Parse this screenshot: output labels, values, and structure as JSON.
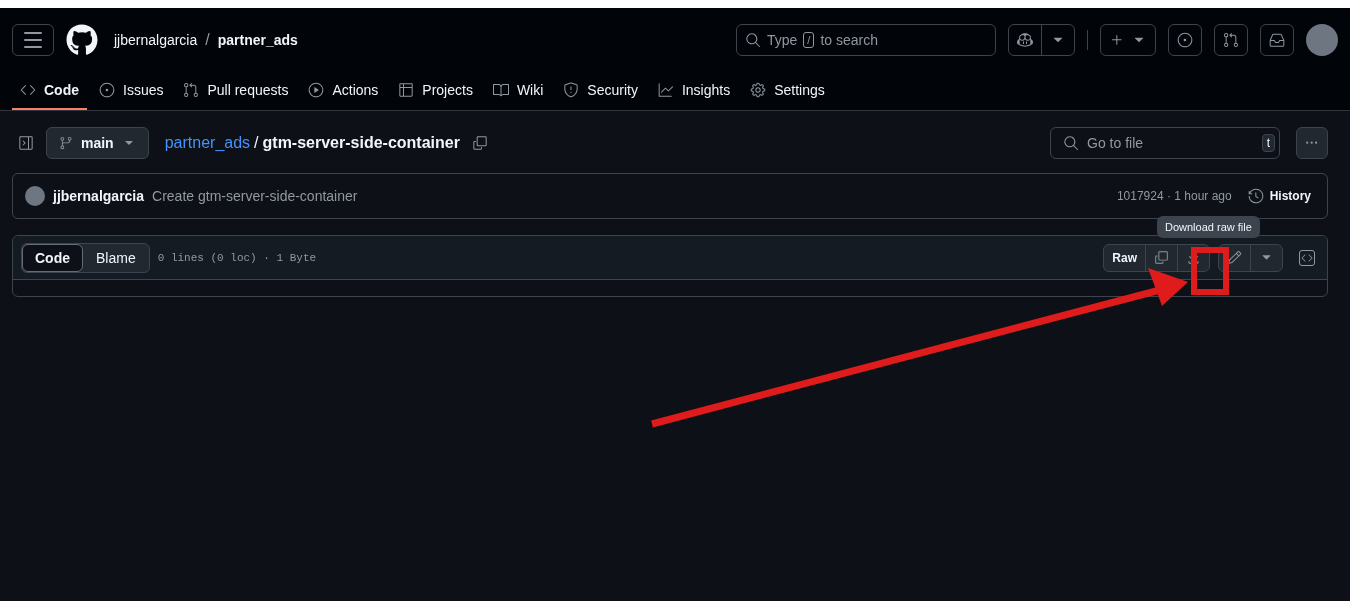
{
  "header": {
    "owner": "jjbernalgarcia",
    "separator": "/",
    "repo": "partner_ads",
    "search": {
      "placeholder_before": "Type",
      "key": "/",
      "placeholder_after": "to search"
    }
  },
  "tabs": [
    {
      "label": "Code",
      "selected": true
    },
    {
      "label": "Issues",
      "selected": false
    },
    {
      "label": "Pull requests",
      "selected": false
    },
    {
      "label": "Actions",
      "selected": false
    },
    {
      "label": "Projects",
      "selected": false
    },
    {
      "label": "Wiki",
      "selected": false
    },
    {
      "label": "Security",
      "selected": false
    },
    {
      "label": "Insights",
      "selected": false
    },
    {
      "label": "Settings",
      "selected": false
    }
  ],
  "file_bar": {
    "branch": "main",
    "path_repo": "partner_ads",
    "path_sep": "/",
    "file_name": "gtm-server-side-container",
    "goto": {
      "placeholder": "Go to file",
      "key": "t"
    }
  },
  "commit": {
    "author": "jjbernalgarcia",
    "message": "Create gtm-server-side-container",
    "sha_time": "1017924 · 1 hour ago",
    "history": "History"
  },
  "viewer": {
    "modes": [
      {
        "label": "Code",
        "selected": true
      },
      {
        "label": "Blame",
        "selected": false
      }
    ],
    "info": "0 lines (0 loc) · 1 Byte",
    "raw": "Raw",
    "tooltip": "Download raw file"
  }
}
